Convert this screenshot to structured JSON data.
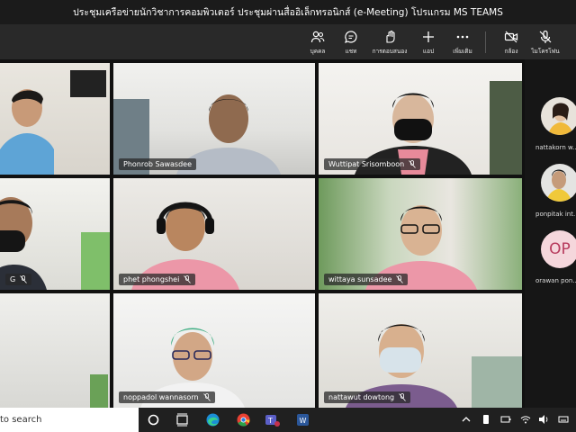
{
  "window": {
    "title": "ประชุมเครือข่ายนักวิชาการคอมพิวเตอร์ ประชุมผ่านสื่ออิเล็กทรอนิกส์ (e-Meeting) โปรแกรม MS TEAMS"
  },
  "toolbar": {
    "people": "บุคคล",
    "chat": "แชท",
    "react": "การตอบสนอง",
    "apps": "แอป",
    "more": "เพิ่มเติม",
    "camera": "กล้อง",
    "mic": "ไมโครโฟน"
  },
  "participants": [
    {
      "name": ""
    },
    {
      "name": "Phonrob Sawasdee"
    },
    {
      "name": "Wuttipat Srisomboon"
    },
    {
      "name": "G"
    },
    {
      "name": "phet phongshei"
    },
    {
      "name": "wittaya sunsadee"
    },
    {
      "name": ""
    },
    {
      "name": "noppadol wannasorn"
    },
    {
      "name": "nattawut dowtong"
    }
  ],
  "sidebar": [
    {
      "name": "nattakorn w..."
    },
    {
      "name": "ponpitak int..."
    },
    {
      "name": "orawan pon...",
      "initials": "OP"
    }
  ],
  "taskbar": {
    "search": "to search"
  },
  "colors": {
    "accent": "#9b9bd6",
    "initials_bg": "#f5d7dc",
    "initials_fg": "#b73a5c"
  }
}
